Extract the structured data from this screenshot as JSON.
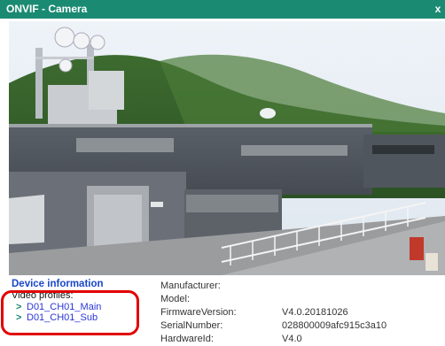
{
  "window": {
    "title": "ONVIF - Camera",
    "close_glyph": "x"
  },
  "device": {
    "heading": "Device information",
    "profiles_label": "Video profiles:",
    "profiles": [
      {
        "chevron": ">",
        "name": "D01_CH01_Main"
      },
      {
        "chevron": ">",
        "name": "D01_CH01_Sub"
      }
    ]
  },
  "details": [
    {
      "label": "Manufacturer:",
      "value": ""
    },
    {
      "label": "Model:",
      "value": ""
    },
    {
      "label": "FirmwareVersion:",
      "value": "V4.0.20181026"
    },
    {
      "label": "SerialNumber:",
      "value": "028800009afc915c3a10"
    },
    {
      "label": "HardwareId:",
      "value": "V4.0"
    }
  ],
  "colors": {
    "titlebar": "#1a8a72",
    "heading": "#1a46c9",
    "profile_link": "#2b36d6",
    "highlight": "#e10000"
  }
}
